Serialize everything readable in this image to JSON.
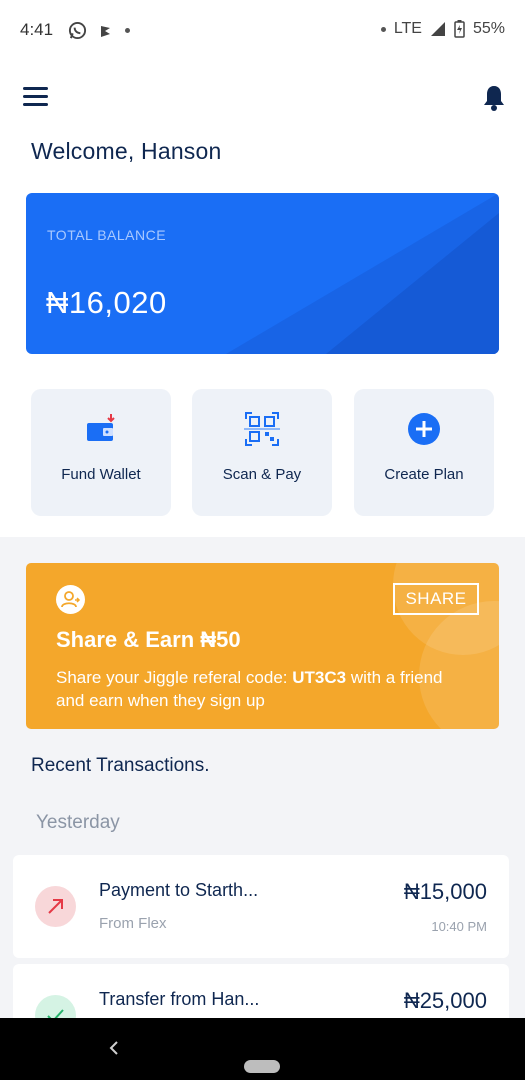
{
  "status_bar": {
    "time": "4:41",
    "network": "LTE",
    "battery": "55%"
  },
  "header": {
    "welcome": "Welcome, Hanson"
  },
  "balance": {
    "label": "TOTAL BALANCE",
    "amount": "₦16,020"
  },
  "actions": [
    {
      "label": "Fund Wallet",
      "icon": "wallet-icon"
    },
    {
      "label": "Scan & Pay",
      "icon": "qr-code-icon"
    },
    {
      "label": "Create Plan",
      "icon": "plus-circle-icon"
    }
  ],
  "promo": {
    "share_label": "SHARE",
    "title": "Share & Earn ₦50",
    "text_before": "Share your Jiggle referal code: ",
    "code": "UT3C3",
    "text_after": " with a friend and earn when they sign up"
  },
  "transactions": {
    "title": "Recent Transactions.",
    "groups": [
      {
        "label": "Yesterday",
        "items": [
          {
            "name": "Payment to Starth...",
            "sub": "From Flex",
            "amount": "₦15,000",
            "time": "10:40 PM",
            "direction": "outgoing"
          },
          {
            "name": "Transfer from Han...",
            "sub": "",
            "amount": "₦25,000",
            "time": "",
            "direction": "incoming"
          }
        ]
      }
    ]
  },
  "colors": {
    "primary": "#1a6ef5",
    "navy": "#0f2750",
    "promo": "#f4a72b",
    "outgoing": "#f8d7d9",
    "incoming": "#d5f3e4"
  }
}
